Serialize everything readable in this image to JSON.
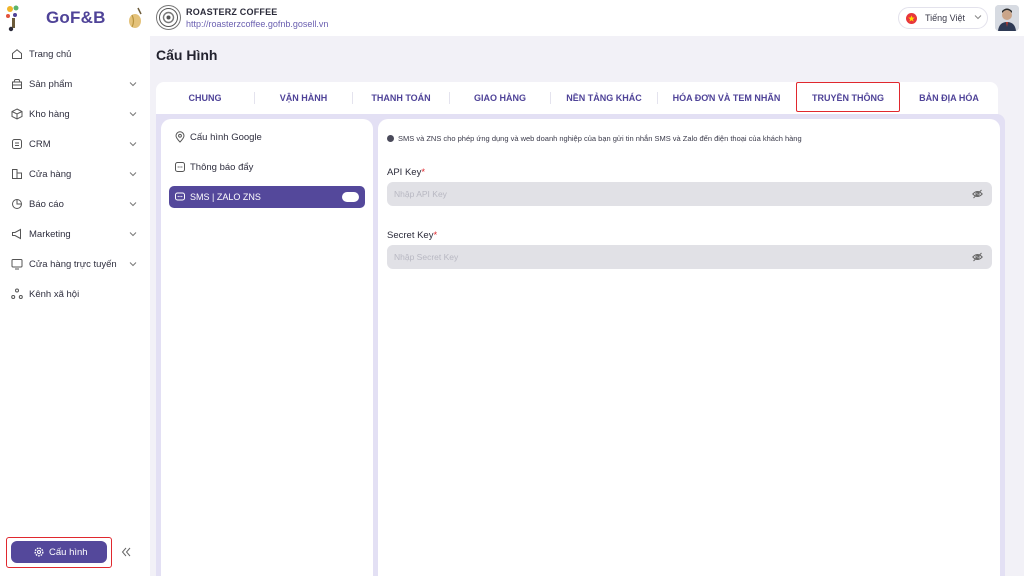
{
  "brand": {
    "logo_text": "GoF&B"
  },
  "store": {
    "name": "ROASTERZ COFFEE",
    "url": "http://roasterzcoffee.gofnb.gosell.vn"
  },
  "language": {
    "selected": "Tiếng Việt"
  },
  "sidebar": {
    "items": [
      {
        "label": "Trang chủ",
        "icon": "home-icon",
        "has_chevron": false
      },
      {
        "label": "Sản phẩm",
        "icon": "product-icon",
        "has_chevron": true
      },
      {
        "label": "Kho hàng",
        "icon": "inventory-icon",
        "has_chevron": true
      },
      {
        "label": "CRM",
        "icon": "crm-icon",
        "has_chevron": true
      },
      {
        "label": "Cửa hàng",
        "icon": "store-icon",
        "has_chevron": true
      },
      {
        "label": "Báo cáo",
        "icon": "report-icon",
        "has_chevron": true
      },
      {
        "label": "Marketing",
        "icon": "marketing-icon",
        "has_chevron": true
      },
      {
        "label": "Cửa hàng trực tuyến",
        "icon": "online-store-icon",
        "has_chevron": true
      },
      {
        "label": "Kênh xã hội",
        "icon": "social-icon",
        "has_chevron": false
      }
    ],
    "config_button": "Cấu hình"
  },
  "page": {
    "title": "Cấu Hình"
  },
  "tabs": [
    {
      "label": "CHUNG",
      "active": false
    },
    {
      "label": "VẬN HÀNH",
      "active": false
    },
    {
      "label": "THANH TOÁN",
      "active": false
    },
    {
      "label": "GIAO HÀNG",
      "active": false
    },
    {
      "label": "NỀN TẢNG KHÁC",
      "active": false
    },
    {
      "label": "HÓA ĐƠN VÀ TEM NHÃN",
      "active": false
    },
    {
      "label": "TRUYỀN THÔNG",
      "active": true
    },
    {
      "label": "BẢN ĐỊA HÓA",
      "active": false
    }
  ],
  "sub_menu": [
    {
      "label": "Cấu hình Google",
      "icon": "location-pin-icon",
      "active": false
    },
    {
      "label": "Thông báo đẩy",
      "icon": "notification-icon",
      "active": false
    },
    {
      "label": "SMS | ZALO ZNS",
      "icon": "chat-icon",
      "active": true,
      "toggle_on": true
    }
  ],
  "sms_panel": {
    "info": "SMS và ZNS cho phép ứng dụng và web doanh nghiệp của bạn gửi tin nhắn SMS và Zalo đến điện thoại của khách hàng",
    "api_key": {
      "label": "API Key",
      "required_mark": "*",
      "value": "",
      "placeholder": "Nhập API Key"
    },
    "secret_key": {
      "label": "Secret Key",
      "required_mark": "*",
      "value": "",
      "placeholder": "Nhập Secret Key"
    }
  },
  "colors": {
    "primary": "#54489b",
    "highlight": "#e0282e",
    "frame": "#e3e0f4"
  }
}
